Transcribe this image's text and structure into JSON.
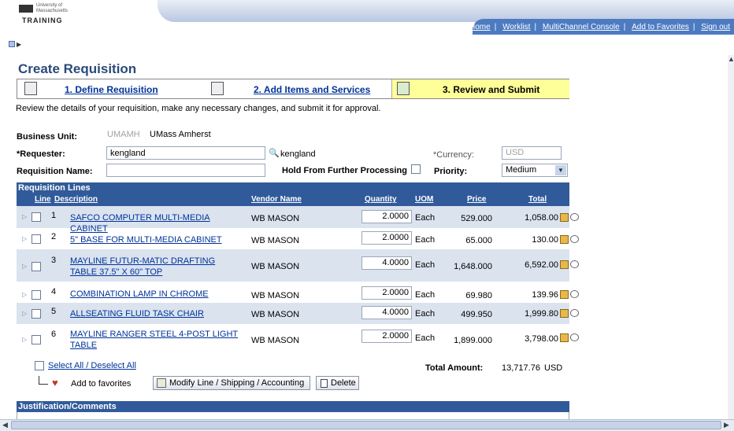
{
  "header": {
    "university": "University of Massachusetts",
    "brand": "TRAINING",
    "nav": [
      "Home",
      "Worklist",
      "MultiChannel Console",
      "Add to Favorites",
      "Sign out"
    ]
  },
  "page_title": "Create Requisition",
  "steps": [
    {
      "label": "1. Define Requisition"
    },
    {
      "label": "2. Add Items and Services"
    },
    {
      "label": "3. Review and Submit"
    }
  ],
  "instructions": "Review the details of your requisition, make any necessary changes, and submit it for approval.",
  "form": {
    "business_unit_label": "Business Unit:",
    "business_unit_value": "UMAMH",
    "business_unit_name": "UMass Amherst",
    "requester_label": "*Requester:",
    "requester_value": "kengland",
    "requester_lookup_text": "kengland",
    "currency_label": "*Currency:",
    "currency_value": "USD",
    "req_name_label": "Requisition Name:",
    "req_name_value": "",
    "hold_label": "Hold From Further Processing",
    "priority_label": "Priority:",
    "priority_value": "Medium"
  },
  "requisition_lines": {
    "title": "Requisition Lines",
    "columns": [
      "Line",
      "Description",
      "Vendor Name",
      "Quantity",
      "UOM",
      "Price",
      "Total"
    ],
    "rows": [
      {
        "line": "1",
        "desc": "SAFCO COMPUTER MULTI-MEDIA CABINET",
        "vendor": "WB MASON",
        "qty": "2.0000",
        "uom": "Each",
        "price": "529.000",
        "total": "1,058.00"
      },
      {
        "line": "2",
        "desc": "5\" BASE FOR MULTI-MEDIA CABINET",
        "vendor": "WB MASON",
        "qty": "2.0000",
        "uom": "Each",
        "price": "65.000",
        "total": "130.00"
      },
      {
        "line": "3",
        "desc": "MAYLINE FUTUR-MATIC DRAFTING TABLE 37.5\" X 60\" TOP",
        "vendor": "WB MASON",
        "qty": "4.0000",
        "uom": "Each",
        "price": "1,648.000",
        "total": "6,592.00"
      },
      {
        "line": "4",
        "desc": "COMBINATION LAMP IN CHROME",
        "vendor": "WB MASON",
        "qty": "2.0000",
        "uom": "Each",
        "price": "69.980",
        "total": "139.96"
      },
      {
        "line": "5",
        "desc": "ALLSEATING FLUID TASK CHAIR",
        "vendor": "WB MASON",
        "qty": "4.0000",
        "uom": "Each",
        "price": "499.950",
        "total": "1,999.80"
      },
      {
        "line": "6",
        "desc": "MAYLINE RANGER STEEL 4-POST LIGHT TABLE",
        "vendor": "WB MASON",
        "qty": "2.0000",
        "uom": "Each",
        "price": "1,899.000",
        "total": "3,798.00"
      }
    ],
    "select_all": "Select All / Deselect All",
    "total_label": "Total Amount:",
    "total_value": "13,717.76",
    "total_currency": "USD",
    "add_fav_label": "Add to favorites",
    "modify_label": "Modify Line / Shipping / Accounting",
    "delete_label": "Delete"
  },
  "justification_title": "Justification/Comments"
}
